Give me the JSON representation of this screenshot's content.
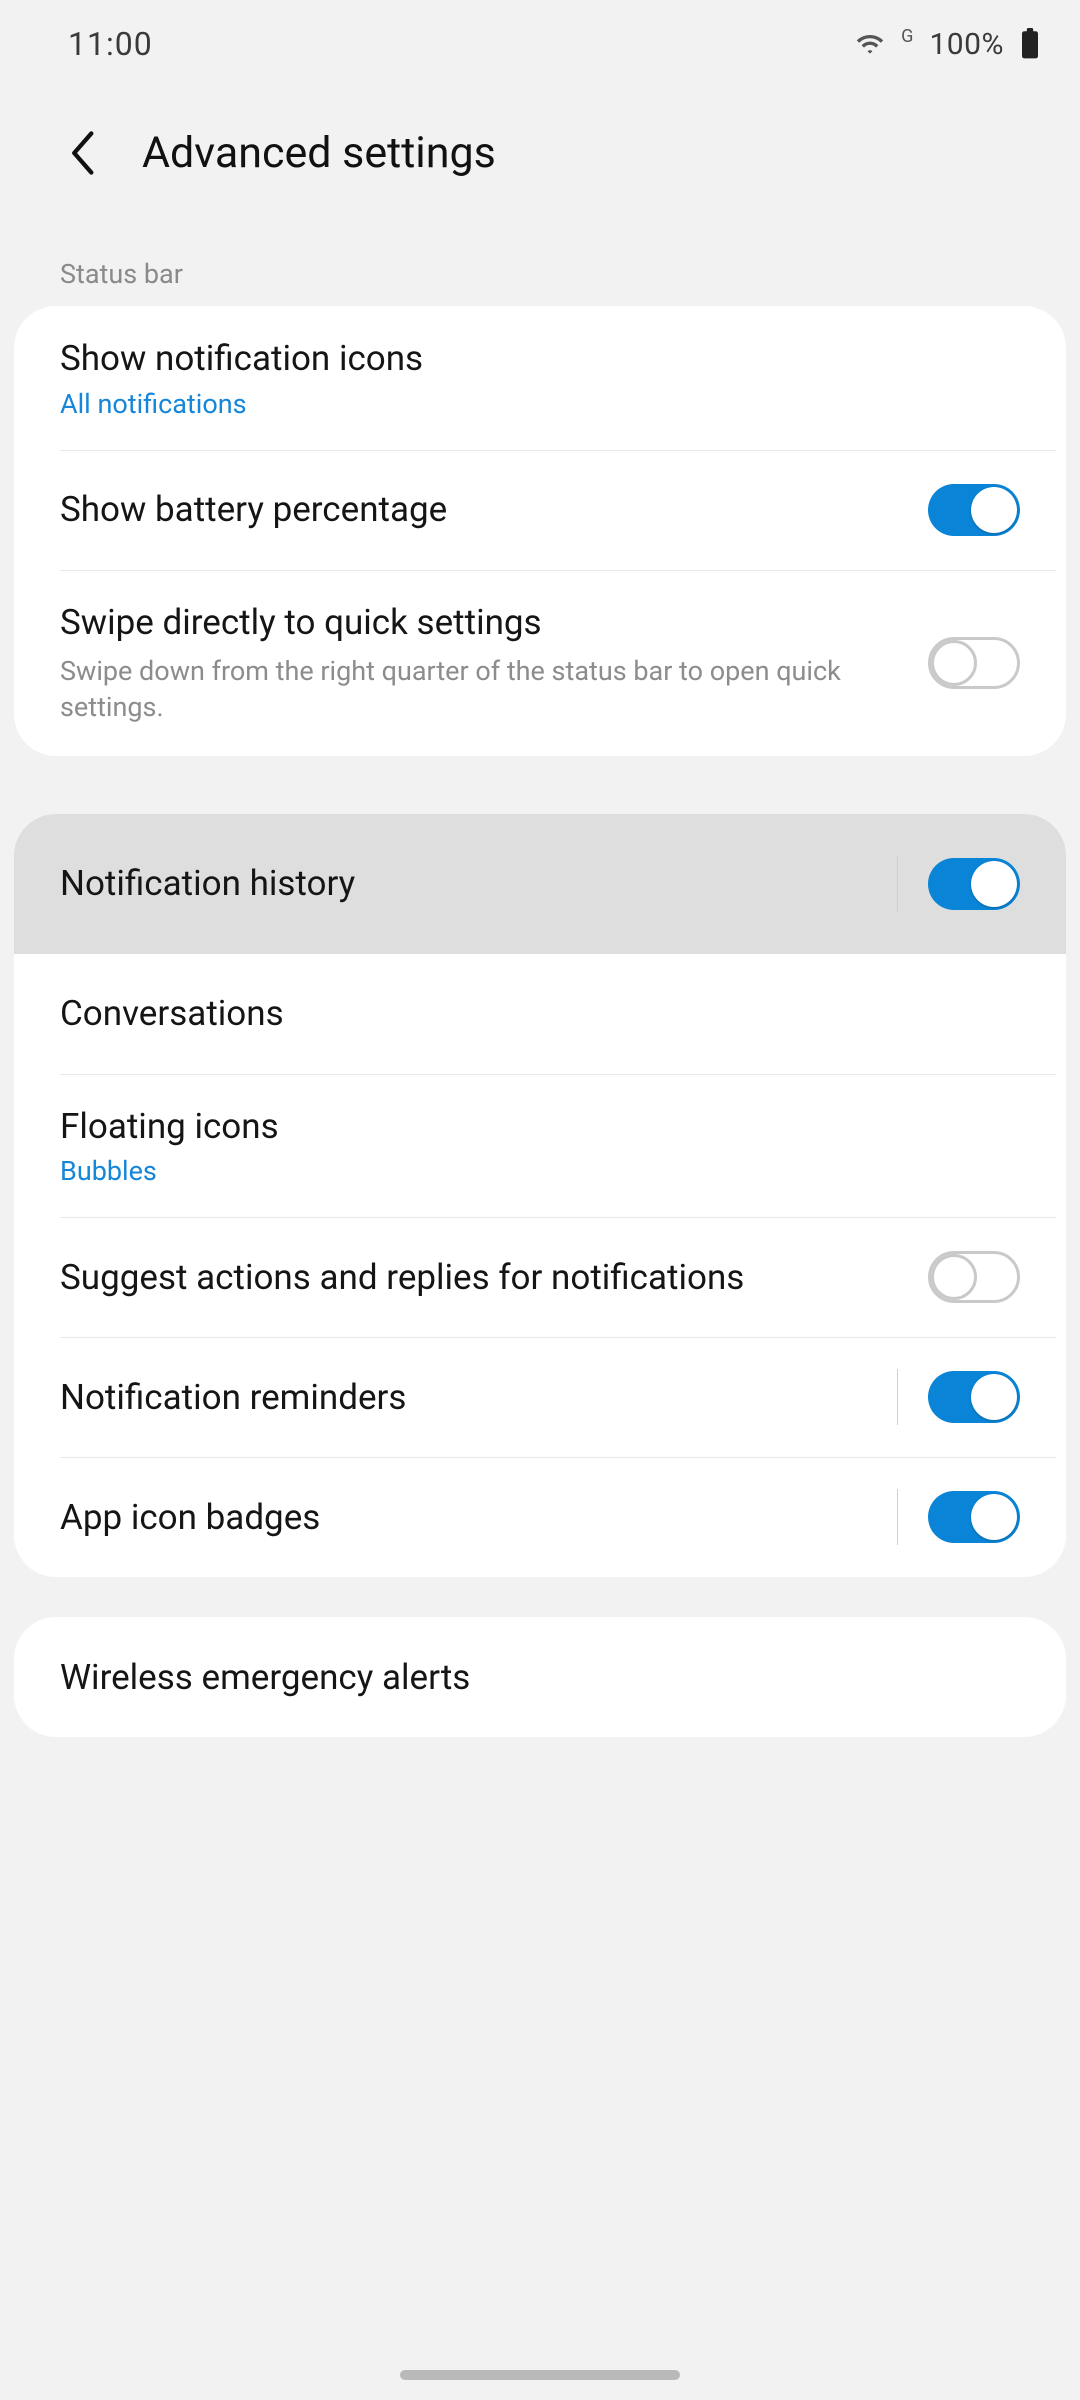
{
  "status": {
    "time": "11:00",
    "network_label": "G",
    "battery_pct": "100%"
  },
  "header": {
    "title": "Advanced settings"
  },
  "section1": {
    "label": "Status bar",
    "items": [
      {
        "title": "Show notification icons",
        "sub": "All notifications"
      },
      {
        "title": "Show battery percentage",
        "toggle": true
      },
      {
        "title": "Swipe directly to quick settings",
        "desc": "Swipe down from the right quarter of the status bar to open quick settings.",
        "toggle": false
      }
    ]
  },
  "highlight": {
    "title": "Notification history",
    "toggle": true
  },
  "section2": {
    "items": [
      {
        "title": "Conversations"
      },
      {
        "title": "Floating icons",
        "sub": "Bubbles"
      },
      {
        "title": "Suggest actions and replies for notifications",
        "toggle": false
      },
      {
        "title": "Notification reminders",
        "toggle": true,
        "sep": true
      },
      {
        "title": "App icon badges",
        "toggle": true,
        "sep": true
      }
    ]
  },
  "section3": {
    "items": [
      {
        "title": "Wireless emergency alerts"
      }
    ]
  }
}
